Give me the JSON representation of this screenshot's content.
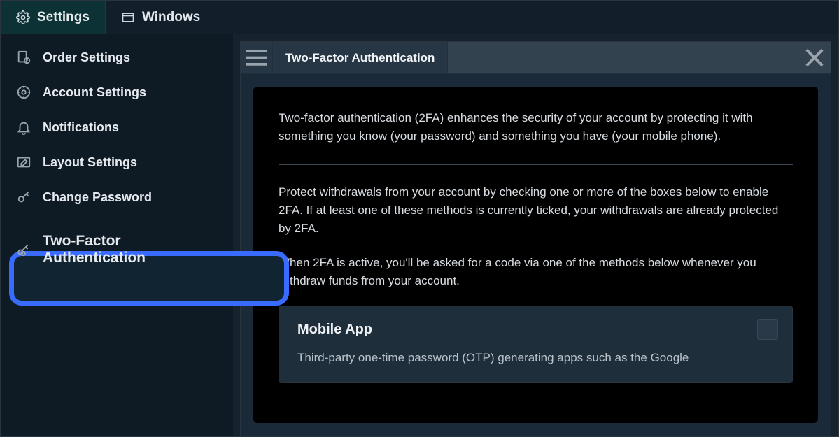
{
  "tabs": {
    "settings": "Settings",
    "windows": "Windows"
  },
  "sidebar": {
    "items": [
      {
        "label": "Order Settings"
      },
      {
        "label": "Account Settings"
      },
      {
        "label": "Notifications"
      },
      {
        "label": "Layout Settings"
      },
      {
        "label": "Change Password"
      },
      {
        "label": "Two-Factor Authentication"
      }
    ]
  },
  "panel": {
    "title": "Two-Factor Authentication",
    "intro": "Two-factor authentication (2FA) enhances the security of your account by protecting it with something you know (your password) and something you have (your mobile phone).",
    "protect": "Protect withdrawals from your account by checking one or more of the boxes below to enable 2FA. If at least one of these methods is currently ticked, your withdrawals are already protected by 2FA.",
    "when": "When 2FA is active, you'll be asked for a code via one of the methods below whenever you withdraw funds from your account.",
    "card": {
      "title": "Mobile App",
      "desc": "Third-party one-time password (OTP) generating apps such as the Google"
    }
  }
}
